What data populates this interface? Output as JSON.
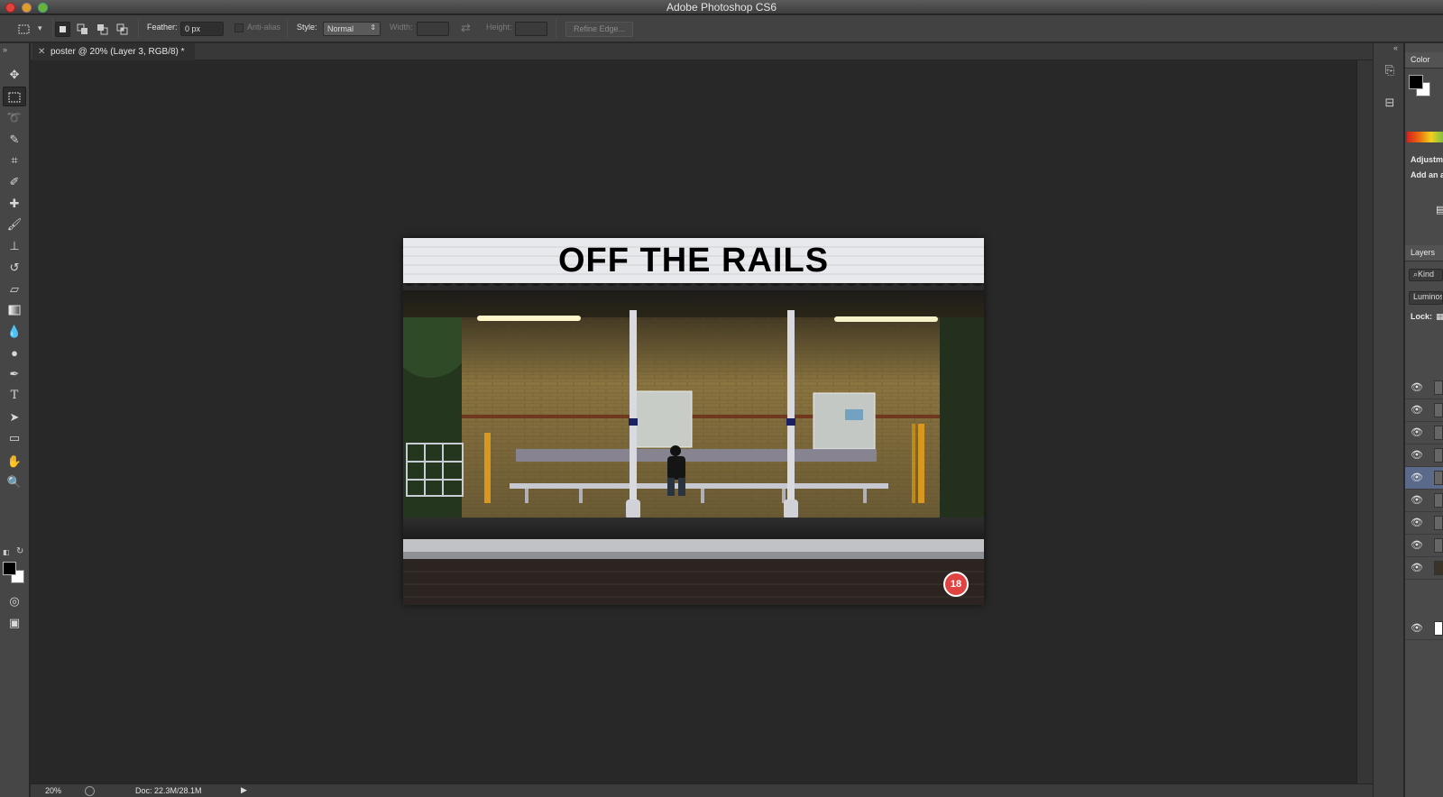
{
  "window": {
    "title": "Adobe Photoshop CS6"
  },
  "options_bar": {
    "feather_label": "Feather:",
    "feather_value": "0 px",
    "anti_alias_label": "Anti-alias",
    "style_label": "Style:",
    "style_value": "Normal",
    "width_label": "Width:",
    "height_label": "Height:",
    "refine_edge_label": "Refine Edge..."
  },
  "document": {
    "tab_title": "poster @ 20% (Layer 3, RGB/8) *",
    "poster_title": "OFF THE RAILS",
    "rating": "18"
  },
  "status_bar": {
    "zoom": "20%",
    "doc_info": "Doc: 22.3M/28.1M"
  },
  "panels": {
    "color_tab": "Color",
    "adjustments_title": "Adjustm",
    "adjustments_hint": "Add an a",
    "layers_tab": "Layers",
    "kind_filter": "Kind",
    "blend_mode": "Luminos",
    "lock_label": "Lock:",
    "layer_count": 10
  },
  "colors": {
    "foreground": "#000000",
    "background": "#ffffff",
    "rating_badge": "#e14343"
  }
}
